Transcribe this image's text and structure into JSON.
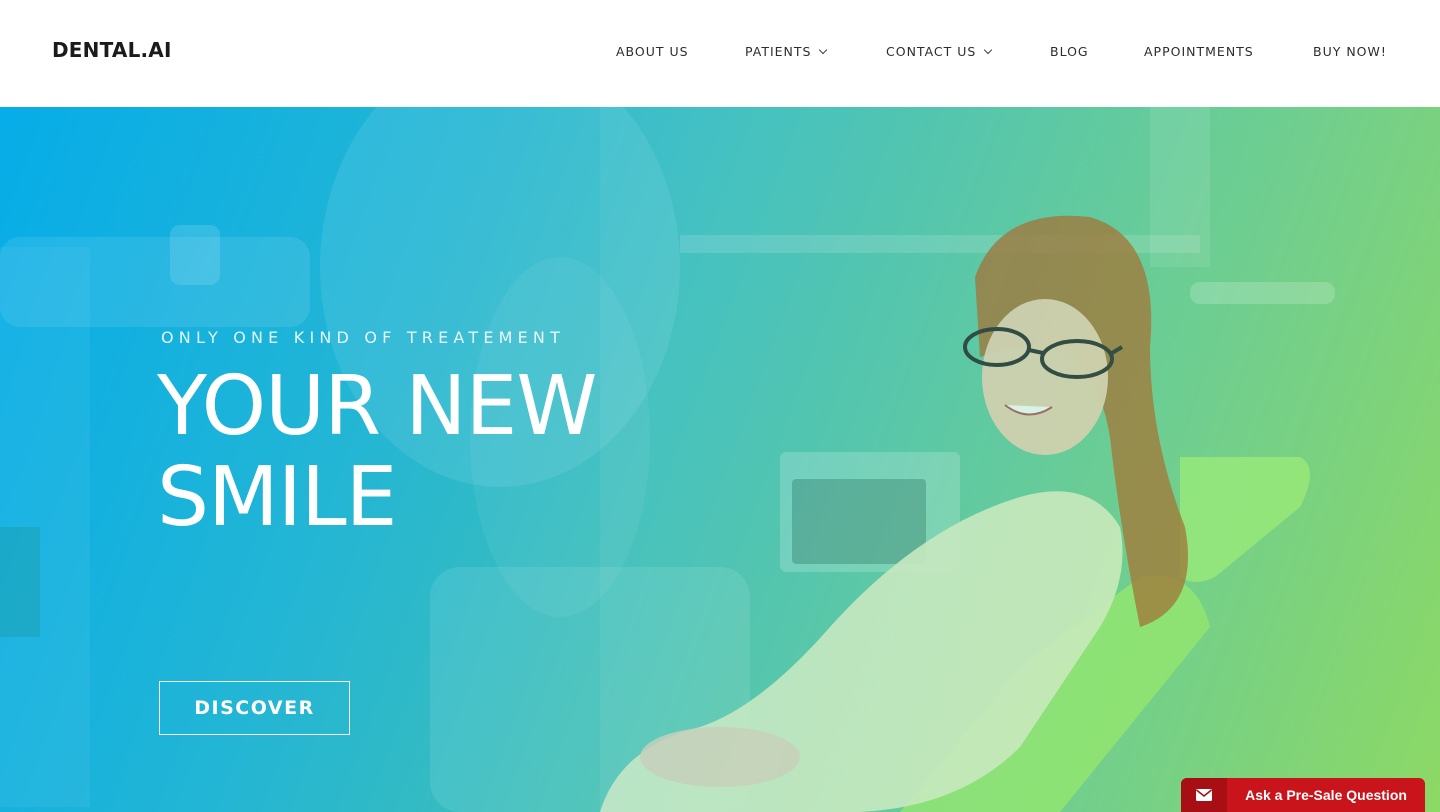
{
  "header": {
    "logo": "DENTAL.AI",
    "nav": [
      {
        "label": "ABOUT US",
        "has_dropdown": false
      },
      {
        "label": "PATIENTS",
        "has_dropdown": true
      },
      {
        "label": "CONTACT US",
        "has_dropdown": true
      },
      {
        "label": "BLOG",
        "has_dropdown": false
      },
      {
        "label": "APPOINTMENTS",
        "has_dropdown": false
      },
      {
        "label": "BUY NOW!",
        "has_dropdown": false
      }
    ]
  },
  "hero": {
    "eyebrow": "ONLY ONE KIND OF TREATEMENT",
    "headline_line1": "YOUR NEW",
    "headline_line2": "SMILE",
    "cta_label": "DISCOVER",
    "gradient_colors": [
      "#0aaee6",
      "#8bd85d"
    ]
  },
  "presale": {
    "icon": "envelope-icon",
    "label": "Ask a Pre-Sale Question",
    "color": "#c8141a"
  }
}
